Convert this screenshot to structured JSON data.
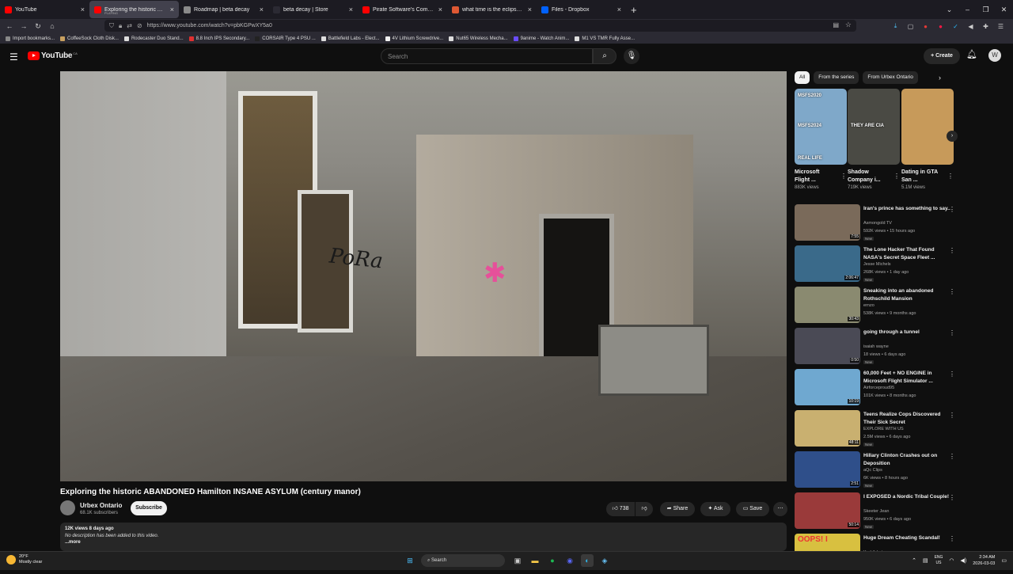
{
  "browser": {
    "tabs": [
      {
        "title": "YouTube",
        "color": "#ff0000",
        "active": false
      },
      {
        "title": "Exploring the historic ABANDONED",
        "subtitle": "PLAYING",
        "color": "#ff0000",
        "active": true
      },
      {
        "title": "Roadmap | beta decay",
        "color": "#8a8a8a",
        "active": false
      },
      {
        "title": "beta decay | Store",
        "color": "#2b2a33",
        "active": false
      },
      {
        "title": "Pirate Software's Comeback Ba",
        "color": "#ff0000",
        "active": false
      },
      {
        "title": "what time is the eclipse at Duci",
        "color": "#de5833",
        "active": false
      },
      {
        "title": "Files - Dropbox",
        "color": "#0061fe",
        "active": false
      }
    ],
    "url": "https://www.youtube.com/watch?v=pbKGPwXY5a0",
    "bookmarks": [
      {
        "label": "Import bookmarks...",
        "color": "#888888"
      },
      {
        "label": "CoffeeSock Cloth Disk...",
        "color": "#c8a060"
      },
      {
        "label": "Rodecaster Duo Stand...",
        "color": "#dddddd"
      },
      {
        "label": "8.8 Inch IPS Secondary...",
        "color": "#e03030"
      },
      {
        "label": "CORSAIR Type 4 PSU ...",
        "color": "#222222"
      },
      {
        "label": "Battlefield Labs - Elect...",
        "color": "#dddddd"
      },
      {
        "label": "4V Lithium Screwdrive...",
        "color": "#f0f0f0"
      },
      {
        "label": "Nut65 Wireless Mecha...",
        "color": "#dddddd"
      },
      {
        "label": "9anime - Watch Anim...",
        "color": "#6a4cff"
      },
      {
        "label": "M1 VS TMR Fully Asse...",
        "color": "#dddddd"
      }
    ]
  },
  "youtube": {
    "logo": "YouTube",
    "country": "CA",
    "search_placeholder": "Search",
    "create_label": "Create",
    "avatar_letter": "W"
  },
  "video": {
    "title": "Exploring the historic ABANDONED Hamilton INSANE ASYLUM (century manor)",
    "channel": "Urbex Ontario",
    "subscribers": "68.1K subscribers",
    "subscribe_label": "Subscribe",
    "likes": "738",
    "share_label": "Share",
    "ask_label": "Ask",
    "save_label": "Save",
    "views_date": "12K views  8 days ago",
    "description": "No description has been added to this video.",
    "more": "...more",
    "graffiti": "PoRa"
  },
  "chips": [
    {
      "label": "All",
      "selected": true
    },
    {
      "label": "From the series",
      "selected": false
    },
    {
      "label": "From Urbex Ontario",
      "selected": false
    }
  ],
  "shelf": [
    {
      "title": "Microsoft Flight ...",
      "views": "883K views",
      "color": "#7fa8c9",
      "badges": [
        "MSFS2020",
        "MSFS2024",
        "REAL LIFE"
      ]
    },
    {
      "title": "Shadow Company i...",
      "views": "719K views",
      "color": "#4a4a44",
      "badges": [
        "THEY ARE CIA"
      ]
    },
    {
      "title": "Dating in GTA San ...",
      "views": "5.1M views",
      "color": "#c79a5a",
      "badges": []
    }
  ],
  "recommendations": [
    {
      "title": "Iran's prince has something to say..",
      "channel": "Asmongold TV",
      "views": "592K views • 15 hours ago",
      "new": "New",
      "duration": "7:55",
      "color": "#7a6a5a"
    },
    {
      "title": "The Lone Hacker That Found NASA's Secret Space Fleet ...",
      "channel": "Jesse Michels",
      "views": "268K views • 1 day ago",
      "new": "New",
      "duration": "2:06:47",
      "color": "#3a6a8a"
    },
    {
      "title": "Sneaking into an abandoned Rothschild Mansion",
      "channel": "ernzo",
      "views": "538K views • 9 months ago",
      "new": "",
      "duration": "30:43",
      "color": "#8a8a70"
    },
    {
      "title": "going through a tunnel",
      "channel": "isaiah wayne",
      "views": "18 views • 6 days ago",
      "new": "New",
      "duration": "0:50",
      "color": "#4a4a55"
    },
    {
      "title": "60,000 Feet + NO ENGINE in Microsoft Flight Simulator ...",
      "channel": "Airforceproud95",
      "views": "101K views • 8 months ago",
      "new": "",
      "duration": "10:19",
      "color": "#6fa8d0"
    },
    {
      "title": "Teens Realize Cops Discovered Their Sick Secret",
      "channel": "EXPLORE WITH US",
      "views": "2.5M views • 6 days ago",
      "new": "New",
      "duration": "48:11",
      "color": "#c9b070"
    },
    {
      "title": "Hillary Clinton Crashes out on Deposition",
      "channel": "aQc Clips",
      "views": "6K views • 8 hours ago",
      "new": "New",
      "duration": "2:51",
      "color": "#2f4f8a"
    },
    {
      "title": "I EXPOSED a Nordic Tribal Couple!",
      "channel": "Skeeter Jean",
      "views": "950K views • 6 days ago",
      "new": "New",
      "duration": "50:14",
      "color": "#9a3a3a"
    },
    {
      "title": "Huge Dream Cheating Scandal!",
      "channel": "Karl Jobst",
      "views": "",
      "new": "",
      "duration": "",
      "color": "#d8c040",
      "overlay": "OOPS! I"
    }
  ],
  "taskbar": {
    "temp": "20°F",
    "weather": "Mostly clear",
    "search": "Search",
    "lang1": "ENG",
    "lang2": "US",
    "time": "2:34 AM",
    "date": "2026-03-03"
  }
}
